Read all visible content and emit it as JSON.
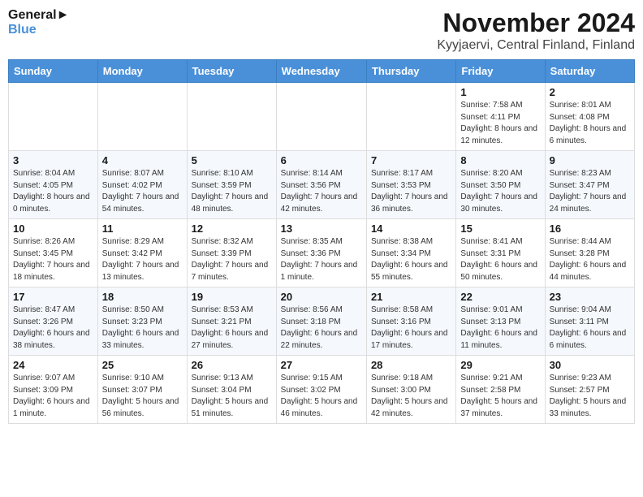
{
  "header": {
    "logo_general": "General",
    "logo_blue": "Blue",
    "month_title": "November 2024",
    "location": "Kyyjaervi, Central Finland, Finland"
  },
  "weekdays": [
    "Sunday",
    "Monday",
    "Tuesday",
    "Wednesday",
    "Thursday",
    "Friday",
    "Saturday"
  ],
  "weeks": [
    [
      {
        "day": "",
        "info": ""
      },
      {
        "day": "",
        "info": ""
      },
      {
        "day": "",
        "info": ""
      },
      {
        "day": "",
        "info": ""
      },
      {
        "day": "",
        "info": ""
      },
      {
        "day": "1",
        "info": "Sunrise: 7:58 AM\nSunset: 4:11 PM\nDaylight: 8 hours and 12 minutes."
      },
      {
        "day": "2",
        "info": "Sunrise: 8:01 AM\nSunset: 4:08 PM\nDaylight: 8 hours and 6 minutes."
      }
    ],
    [
      {
        "day": "3",
        "info": "Sunrise: 8:04 AM\nSunset: 4:05 PM\nDaylight: 8 hours and 0 minutes."
      },
      {
        "day": "4",
        "info": "Sunrise: 8:07 AM\nSunset: 4:02 PM\nDaylight: 7 hours and 54 minutes."
      },
      {
        "day": "5",
        "info": "Sunrise: 8:10 AM\nSunset: 3:59 PM\nDaylight: 7 hours and 48 minutes."
      },
      {
        "day": "6",
        "info": "Sunrise: 8:14 AM\nSunset: 3:56 PM\nDaylight: 7 hours and 42 minutes."
      },
      {
        "day": "7",
        "info": "Sunrise: 8:17 AM\nSunset: 3:53 PM\nDaylight: 7 hours and 36 minutes."
      },
      {
        "day": "8",
        "info": "Sunrise: 8:20 AM\nSunset: 3:50 PM\nDaylight: 7 hours and 30 minutes."
      },
      {
        "day": "9",
        "info": "Sunrise: 8:23 AM\nSunset: 3:47 PM\nDaylight: 7 hours and 24 minutes."
      }
    ],
    [
      {
        "day": "10",
        "info": "Sunrise: 8:26 AM\nSunset: 3:45 PM\nDaylight: 7 hours and 18 minutes."
      },
      {
        "day": "11",
        "info": "Sunrise: 8:29 AM\nSunset: 3:42 PM\nDaylight: 7 hours and 13 minutes."
      },
      {
        "day": "12",
        "info": "Sunrise: 8:32 AM\nSunset: 3:39 PM\nDaylight: 7 hours and 7 minutes."
      },
      {
        "day": "13",
        "info": "Sunrise: 8:35 AM\nSunset: 3:36 PM\nDaylight: 7 hours and 1 minute."
      },
      {
        "day": "14",
        "info": "Sunrise: 8:38 AM\nSunset: 3:34 PM\nDaylight: 6 hours and 55 minutes."
      },
      {
        "day": "15",
        "info": "Sunrise: 8:41 AM\nSunset: 3:31 PM\nDaylight: 6 hours and 50 minutes."
      },
      {
        "day": "16",
        "info": "Sunrise: 8:44 AM\nSunset: 3:28 PM\nDaylight: 6 hours and 44 minutes."
      }
    ],
    [
      {
        "day": "17",
        "info": "Sunrise: 8:47 AM\nSunset: 3:26 PM\nDaylight: 6 hours and 38 minutes."
      },
      {
        "day": "18",
        "info": "Sunrise: 8:50 AM\nSunset: 3:23 PM\nDaylight: 6 hours and 33 minutes."
      },
      {
        "day": "19",
        "info": "Sunrise: 8:53 AM\nSunset: 3:21 PM\nDaylight: 6 hours and 27 minutes."
      },
      {
        "day": "20",
        "info": "Sunrise: 8:56 AM\nSunset: 3:18 PM\nDaylight: 6 hours and 22 minutes."
      },
      {
        "day": "21",
        "info": "Sunrise: 8:58 AM\nSunset: 3:16 PM\nDaylight: 6 hours and 17 minutes."
      },
      {
        "day": "22",
        "info": "Sunrise: 9:01 AM\nSunset: 3:13 PM\nDaylight: 6 hours and 11 minutes."
      },
      {
        "day": "23",
        "info": "Sunrise: 9:04 AM\nSunset: 3:11 PM\nDaylight: 6 hours and 6 minutes."
      }
    ],
    [
      {
        "day": "24",
        "info": "Sunrise: 9:07 AM\nSunset: 3:09 PM\nDaylight: 6 hours and 1 minute."
      },
      {
        "day": "25",
        "info": "Sunrise: 9:10 AM\nSunset: 3:07 PM\nDaylight: 5 hours and 56 minutes."
      },
      {
        "day": "26",
        "info": "Sunrise: 9:13 AM\nSunset: 3:04 PM\nDaylight: 5 hours and 51 minutes."
      },
      {
        "day": "27",
        "info": "Sunrise: 9:15 AM\nSunset: 3:02 PM\nDaylight: 5 hours and 46 minutes."
      },
      {
        "day": "28",
        "info": "Sunrise: 9:18 AM\nSunset: 3:00 PM\nDaylight: 5 hours and 42 minutes."
      },
      {
        "day": "29",
        "info": "Sunrise: 9:21 AM\nSunset: 2:58 PM\nDaylight: 5 hours and 37 minutes."
      },
      {
        "day": "30",
        "info": "Sunrise: 9:23 AM\nSunset: 2:57 PM\nDaylight: 5 hours and 33 minutes."
      }
    ]
  ]
}
